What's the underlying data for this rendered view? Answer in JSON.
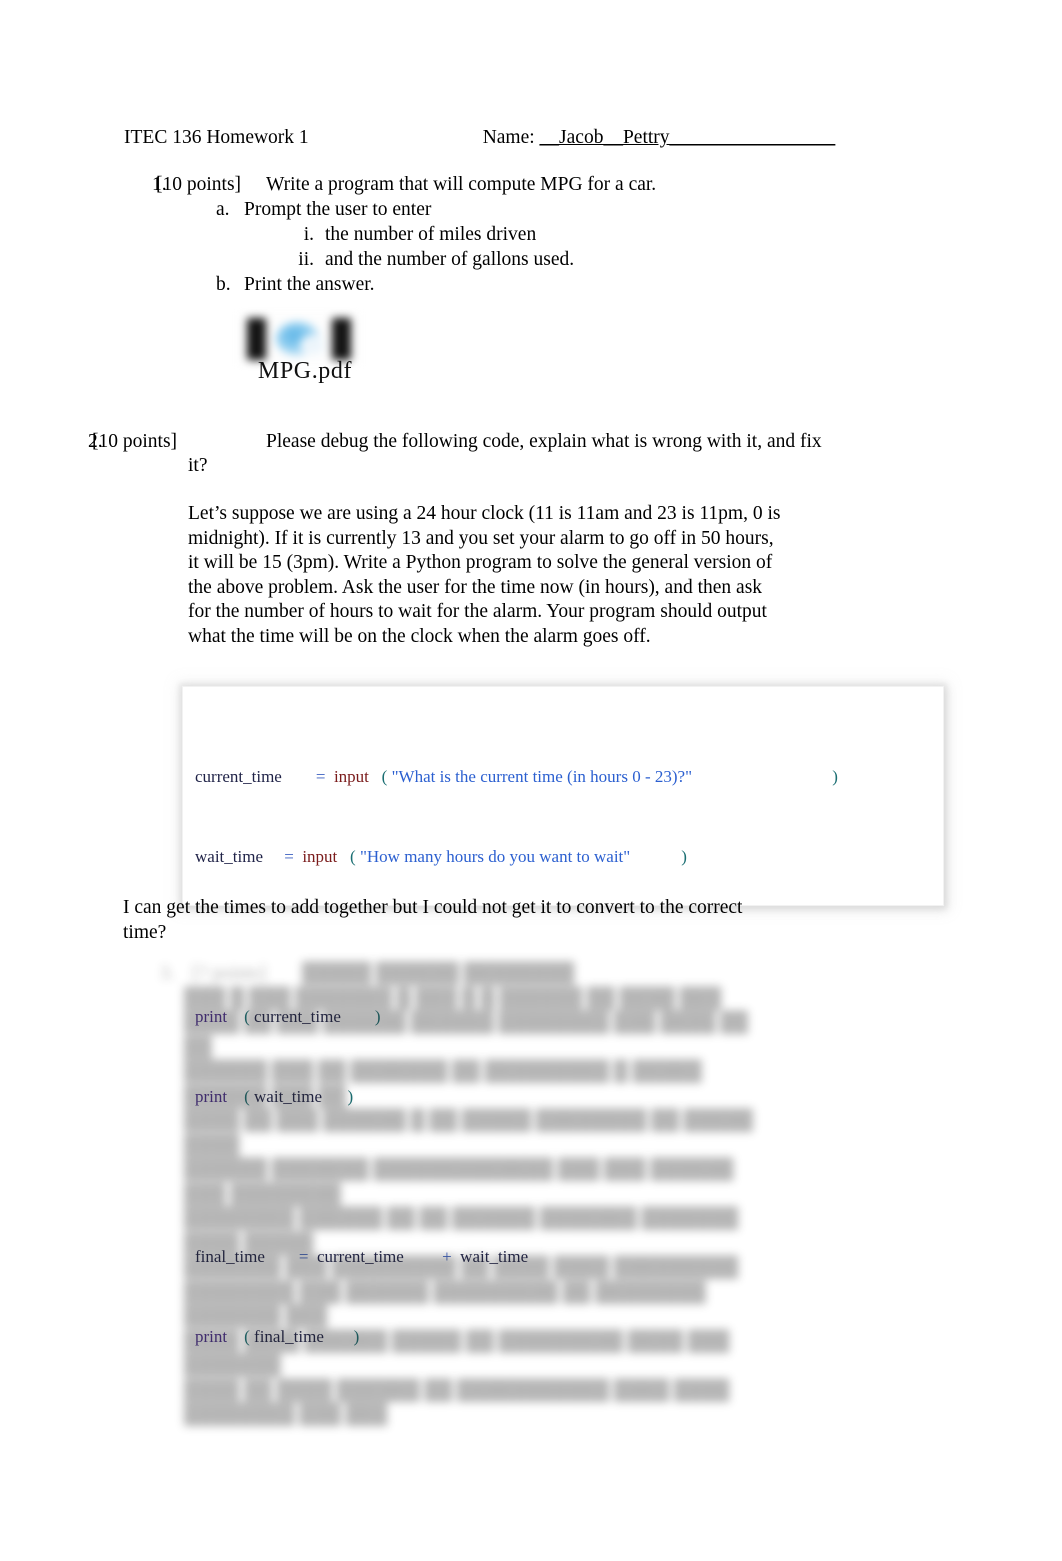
{
  "document": {
    "header": {
      "course_title": "ITEC 136 Homework 1",
      "name_label": "Name:",
      "name_value": "__Jacob__Pettry",
      "name_blank": "_________________"
    },
    "questions": [
      {
        "number": "1.",
        "points": "[10 points]",
        "prompt": "Write a program that will compute MPG for a car.",
        "sub_items": [
          {
            "marker": "a.",
            "text": "Prompt the user to enter"
          },
          {
            "marker": "i.",
            "text": "the number of miles driven"
          },
          {
            "marker": "ii.",
            "text": "and the number of gallons used."
          },
          {
            "marker": "b.",
            "text": "Print the answer."
          }
        ],
        "attachment": {
          "filename": "MPG.pdf",
          "icon": "embedded-pdf-object-icon"
        }
      },
      {
        "number": "2.",
        "points": "[10 points]",
        "prompt": "Please debug the following code, explain what is wrong with it, and fix it?",
        "body": "Let’s suppose we are using a 24 hour clock (11 is 11am and 23 is 11pm, 0 is midnight). If it is currently 13 and you set your alarm to go off in 50 hours, it will be 15 (3pm). Write a Python program to solve the general version of the above problem. Ask the user for the time now (in hours), and then ask for the number of hours to wait for the alarm. Your program should output what the time will be on the clock when the alarm goes off."
      }
    ],
    "code_block": {
      "language": "python",
      "lines": [
        {
          "id": "line1",
          "var": "current_time",
          "var_pad": "        ",
          "eq": "=",
          "fn": "input",
          "open_paren": "(",
          "string": "\"What is the current time (in hours 0 - 23)?\"",
          "close_pad": "                                 ",
          "close_paren": ")"
        },
        {
          "id": "line2",
          "var": "wait_time",
          "var_pad": "     ",
          "eq": "=",
          "fn": "input",
          "open_paren": "(",
          "string": "\"How many hours do you want to wait\"",
          "close_pad": "            ",
          "close_paren": ")"
        },
        {
          "id": "line3",
          "print": "print",
          "open_paren": "(",
          "arg": "current_time",
          "close_pad": "        ",
          "close_paren": ")"
        },
        {
          "id": "line4",
          "print": "print",
          "open_paren": "(",
          "arg": "wait_time",
          "close_pad": "      ",
          "close_paren": ")"
        },
        {
          "id": "line5",
          "var": "final_time",
          "var_pad": "        ",
          "eq": "=",
          "operand_a": "current_time",
          "op_pad": "         ",
          "plus": "+",
          "operand_b": "wait_time"
        },
        {
          "id": "line6",
          "print": "print",
          "open_paren": "(",
          "arg": "final_time",
          "close_pad": "       ",
          "close_paren": ")"
        }
      ],
      "colors": {
        "variable": "#1f2247",
        "equals": "#3b5fc0",
        "function": "#7a1b1b",
        "paren": "#1a6e72",
        "string": "#2b5fd0",
        "print": "#4b2d8f",
        "plus": "#3b5fc0"
      }
    },
    "answer_note": "I can get the times to add together but I could not get it to convert to the correct time?",
    "redacted_section": {
      "note": "illegible-blurred-block",
      "number": "3.",
      "points": "[? points]",
      "prompt": "█████ ██████ ████████",
      "lines": [
        "███ █ ███ ███████ █ ███ █ █ ██████ ██ ████ ███",
        "████ ██ ███ ██████ ██████ ████████ ███ ████ ██ ██",
        "██████ ███ ██ ███████ ██ █████████ █ █████ ██████ ███ ██",
        "████ ██ ███ ██████ █ ██ █████ ████████ ██ █████ ████",
        "██████ ███████ █████████████ ███ ███ ██████ ███ ████████",
        "████████ ██████ ██ ██ ██████ ███████ ███████ ████ █████",
        "███████ ███ █████████ ██ ████ ████ █████████",
        "████████ ███ ██████ █████████ ██ ████████ ███████ ███",
        "████ ████ ██████ █████ ██ █████████ ████ ███ ███████",
        "████ ██ ████ ██████ ██ ███████████ ████ ████ ████████ ███ ███"
      ]
    }
  }
}
